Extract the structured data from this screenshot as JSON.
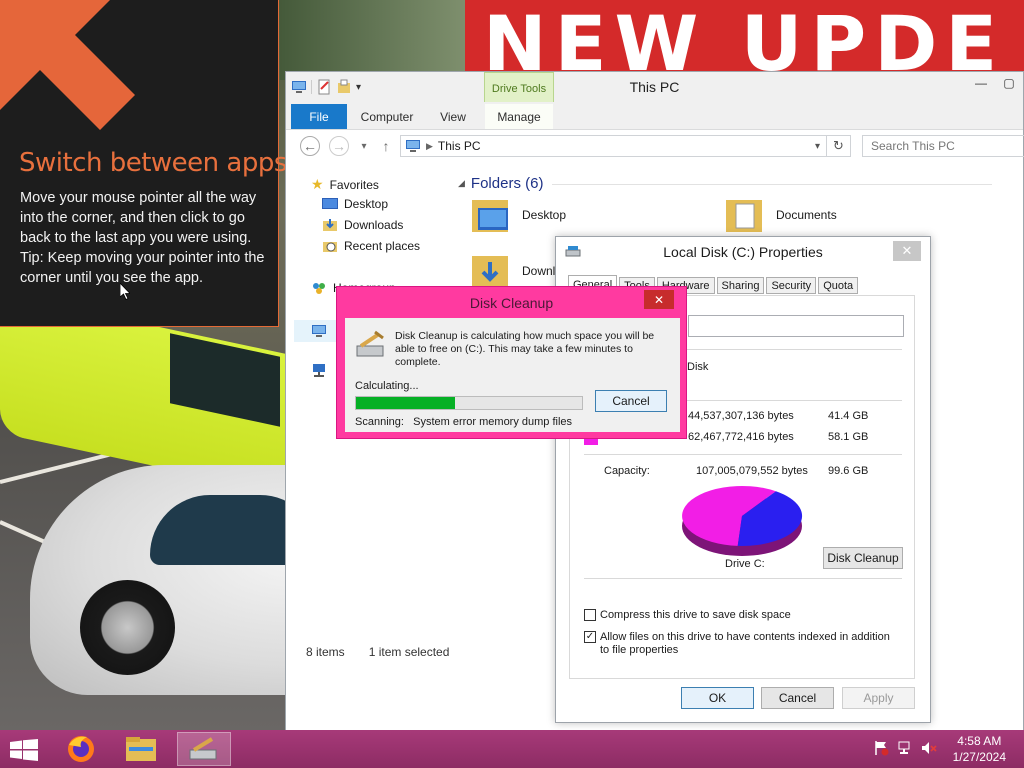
{
  "wallpaper": {
    "banner_text": "NEW UPDE"
  },
  "tip": {
    "title": "Switch between apps",
    "body": "Move your mouse pointer all the way into the corner, and then click to go back to the last app you were using.",
    "tip": "Tip: Keep moving your pointer into the corner until you see the app.",
    "accent": "#e8703d"
  },
  "explorer": {
    "title": "This PC",
    "contextual_tab_group": "Drive Tools",
    "tabs": [
      "File",
      "Computer",
      "View",
      "Manage"
    ],
    "address": "This PC",
    "search_placeholder": "Search This PC",
    "nav": {
      "favorites": "Favorites",
      "desktop": "Desktop",
      "downloads": "Downloads",
      "recent": "Recent places",
      "homegroup": "Homegroup"
    },
    "group_title": "Folders (6)",
    "folders": [
      "Desktop",
      "Documents",
      "Downloads"
    ],
    "status": {
      "items": "8 items",
      "selected": "1 item selected"
    },
    "accent": "#1979ca"
  },
  "properties": {
    "title": "Local Disk (C:) Properties",
    "tabs": [
      "General",
      "Tools",
      "Hardware",
      "Sharing",
      "Security",
      "Quota"
    ],
    "type_value": "Disk",
    "used": {
      "bytes": "44,537,307,136 bytes",
      "size": "41.4 GB",
      "color": "#2a1ff0"
    },
    "free": {
      "bytes": "62,467,772,416 bytes",
      "size": "58.1 GB",
      "color": "#f21ee6"
    },
    "capacity": {
      "label": "Capacity:",
      "bytes": "107,005,079,552 bytes",
      "size": "99.6 GB"
    },
    "drive_label": "Drive C:",
    "disk_cleanup_button": "Disk Cleanup",
    "compress_label": "Compress this drive to save disk space",
    "compress_checked": false,
    "index_label": "Allow files on this drive to have contents indexed in addition to file properties",
    "index_checked": true,
    "buttons": {
      "ok": "OK",
      "cancel": "Cancel",
      "apply": "Apply"
    },
    "pie": {
      "used_fraction": 0.416,
      "free_fraction": 0.584
    }
  },
  "cleanup": {
    "title": "Disk Cleanup",
    "message": "Disk Cleanup is calculating how much space you will be able to free on  (C:). This may take a few minutes to complete.",
    "calculating": "Calculating...",
    "cancel": "Cancel",
    "scanning_label": "Scanning:",
    "scanning_item": "System error memory dump files",
    "progress": 0.44,
    "frame_color": "#ff3aa0"
  },
  "taskbar": {
    "apps": [
      "firefox-icon",
      "file-explorer-icon",
      "disk-cleanup-icon"
    ],
    "time": "4:58 AM",
    "date": "1/27/2024",
    "color": "#a73a79"
  }
}
